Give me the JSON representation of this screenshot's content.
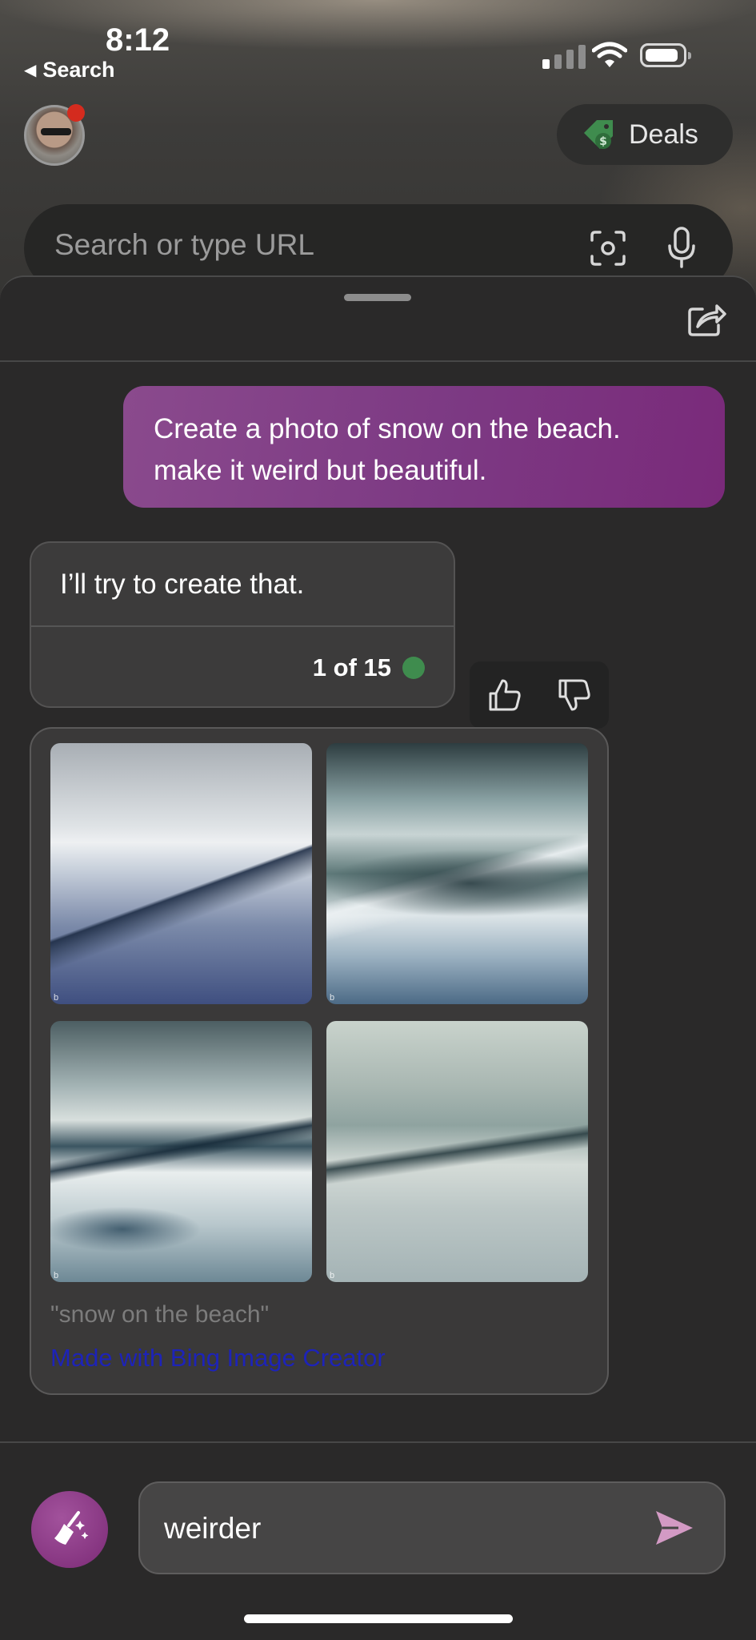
{
  "status_bar": {
    "time": "8:12",
    "back_label": "Search"
  },
  "header": {
    "deals_label": "Deals"
  },
  "url_bar": {
    "placeholder": "Search or type URL"
  },
  "chat": {
    "user_message": "Create a photo of snow on the beach. make it weird but beautiful.",
    "bot_message": "I’ll try to create that.",
    "counter": "1 of 15",
    "image_caption": "\"snow on the beach\"",
    "image_credit": "Made with Bing Image Creator"
  },
  "composer": {
    "input_value": "weirder"
  },
  "colors": {
    "accent_purple": "#7c3983",
    "counter_green": "#3f8c4e",
    "link_blue": "#1d23b8",
    "notification_red": "#d42b1e"
  },
  "icons": [
    "wifi-icon",
    "battery-icon",
    "price-tag-icon",
    "scan-icon",
    "microphone-icon",
    "share-icon",
    "thumbs-up-icon",
    "thumbs-down-icon",
    "broom-icon",
    "send-icon"
  ]
}
